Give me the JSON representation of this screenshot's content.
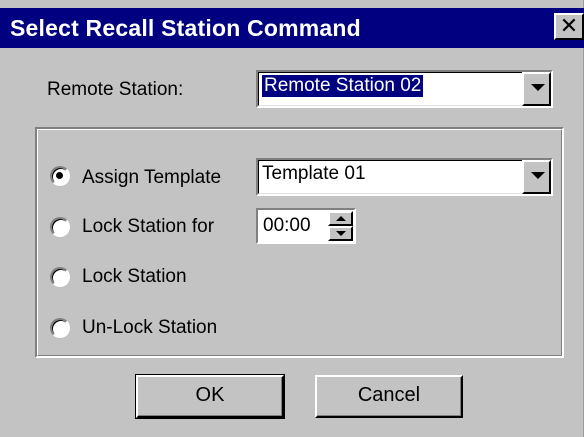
{
  "window": {
    "title": "Select Recall Station Command",
    "close_symbol": "✕"
  },
  "remote_station": {
    "label": "Remote Station:",
    "value": "Remote Station 02"
  },
  "options": [
    {
      "label": "Assign Template",
      "checked": true
    },
    {
      "label": "Lock Station for",
      "checked": false
    },
    {
      "label": "Lock Station",
      "checked": false
    },
    {
      "label": "Un-Lock Station",
      "checked": false
    }
  ],
  "template_select": {
    "value": "Template 01"
  },
  "lock_duration": {
    "value": "00:00"
  },
  "buttons": {
    "ok": "OK",
    "cancel": "Cancel"
  },
  "colors": {
    "titlebar": "#000080",
    "face": "#c3c3c3",
    "selection": "#000080"
  },
  "icons": {
    "close": "close-icon",
    "dropdown": "chevron-down-icon",
    "spin_up": "arrow-up-icon",
    "spin_down": "arrow-down-icon"
  }
}
